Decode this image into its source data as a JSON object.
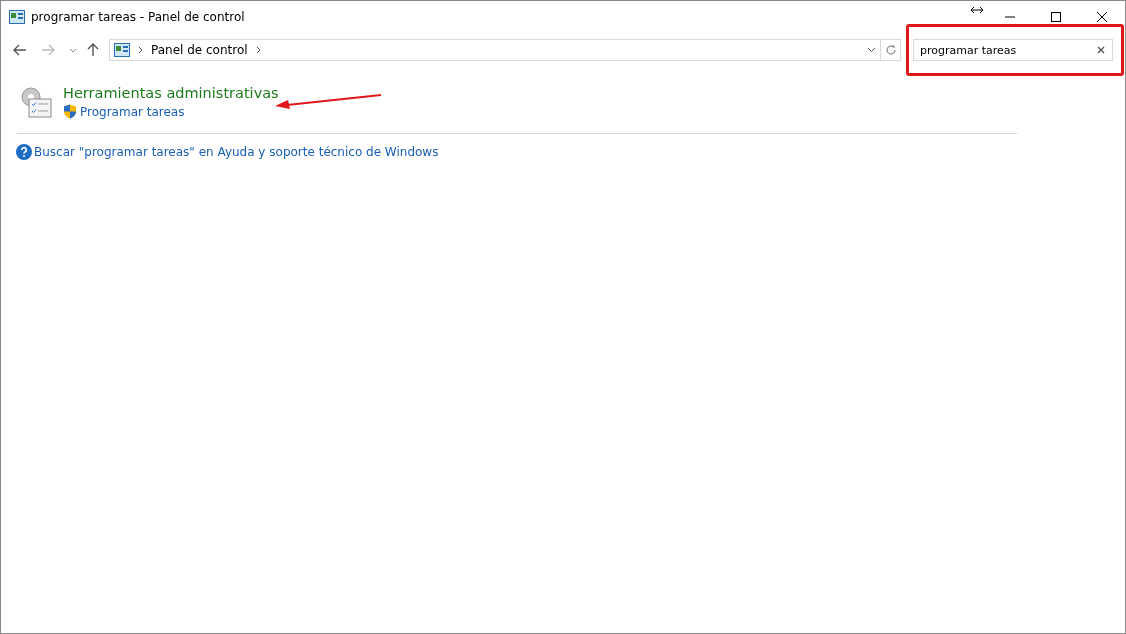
{
  "window": {
    "title": "programar tareas - Panel de control"
  },
  "address_bar": {
    "path": [
      "Panel de control"
    ]
  },
  "search": {
    "value": "programar tareas"
  },
  "results": [
    {
      "category": "Herramientas administrativas",
      "links": [
        "Programar tareas"
      ]
    }
  ],
  "help_link": "Buscar \"programar tareas\" en Ayuda y soporte técnico de Windows"
}
